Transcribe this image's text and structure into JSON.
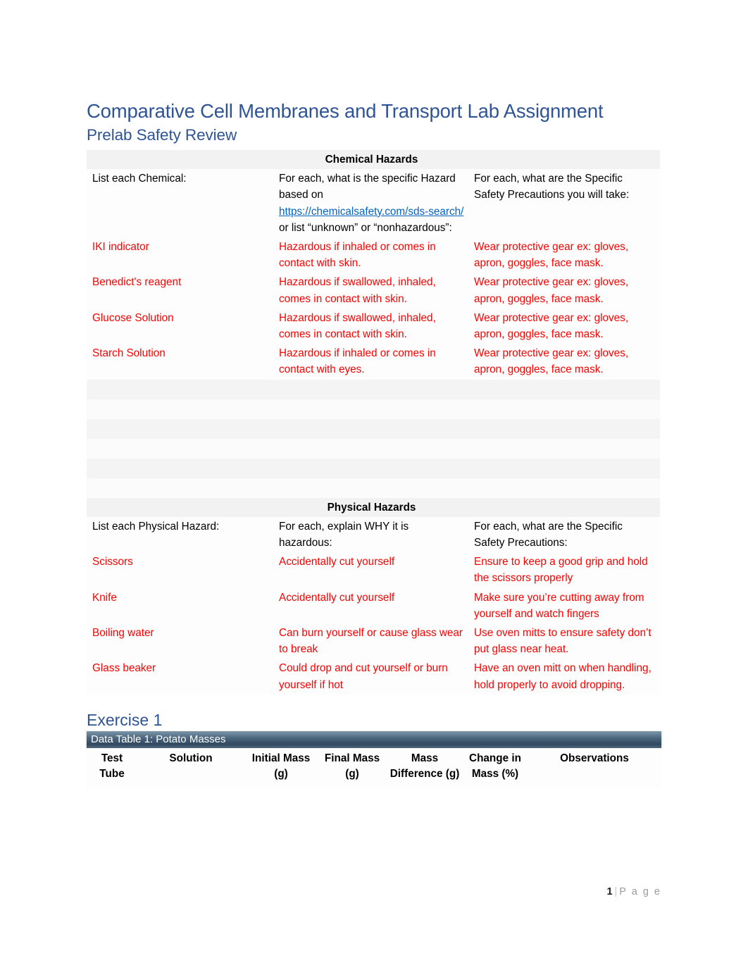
{
  "document": {
    "title": "Comparative Cell Membranes and Transport Lab Assignment",
    "subtitle": "Prelab Safety Review"
  },
  "chemical_hazards": {
    "section_label": "Chemical Hazards",
    "headers": {
      "col1": "List each Chemical:",
      "col2_pre": "For each, what is the specific Hazard based on ",
      "col2_link": "https://chemicalsafety.com/sds-search/",
      "col2_post": " or list “unknown” or “nonhazardous”:",
      "col3": "For each, what are the Specific Safety Precautions you will take:"
    },
    "rows": [
      {
        "chemical": "IKI indicator",
        "hazard": "Hazardous if inhaled or comes in contact with skin.",
        "precaution": "Wear protective gear ex: gloves, apron, goggles, face mask."
      },
      {
        "chemical": "Benedict's reagent",
        "hazard": "Hazardous if swallowed, inhaled, comes in contact with skin.",
        "precaution": "Wear protective gear ex: gloves, apron, goggles, face mask."
      },
      {
        "chemical": "Glucose Solution",
        "hazard": "Hazardous if swallowed, inhaled, comes in contact with skin.",
        "precaution": "Wear protective gear ex: gloves, apron, goggles, face mask."
      },
      {
        "chemical": "Starch Solution",
        "hazard": "Hazardous if inhaled or comes in contact with eyes.",
        "precaution": "Wear protective gear ex: gloves, apron, goggles, face mask."
      }
    ],
    "blank_row_count": 6
  },
  "physical_hazards": {
    "section_label": "Physical Hazards",
    "headers": {
      "col1": "List each Physical Hazard:",
      "col2": "For each, explain WHY it is hazardous:",
      "col3": "For each, what are the Specific Safety Precautions:"
    },
    "rows": [
      {
        "hazard": "Scissors",
        "why": "Accidentally cut yourself",
        "precaution": "Ensure to keep a good grip and hold the scissors properly"
      },
      {
        "hazard": "Knife",
        "why": "Accidentally cut yourself",
        "precaution": "Make sure you’re cutting away from yourself and watch fingers"
      },
      {
        "hazard": "Boiling water",
        "why": "Can burn yourself or cause glass wear to break",
        "precaution": "Use oven mitts to ensure safety don’t put glass near heat."
      },
      {
        "hazard": "Glass beaker",
        "why": "Could drop and cut yourself or burn yourself if hot",
        "precaution": "Have an oven mitt on when handling, hold properly to avoid dropping."
      }
    ]
  },
  "exercise": {
    "heading": "Exercise 1",
    "data_table": {
      "caption": "Data Table 1: Potato Masses",
      "columns": [
        "Test Tube",
        "Solution",
        "Initial Mass (g)",
        "Final Mass (g)",
        "Mass Difference (g)",
        "Change in Mass (%)",
        "Observations"
      ]
    }
  },
  "footer": {
    "page_number": "1",
    "separator": "|",
    "page_label": "P a g e"
  },
  "colors": {
    "heading_blue": "#2F5496",
    "answer_red": "#ff0000",
    "link_blue": "#0563c1",
    "caption_bar": "#3d566e"
  }
}
